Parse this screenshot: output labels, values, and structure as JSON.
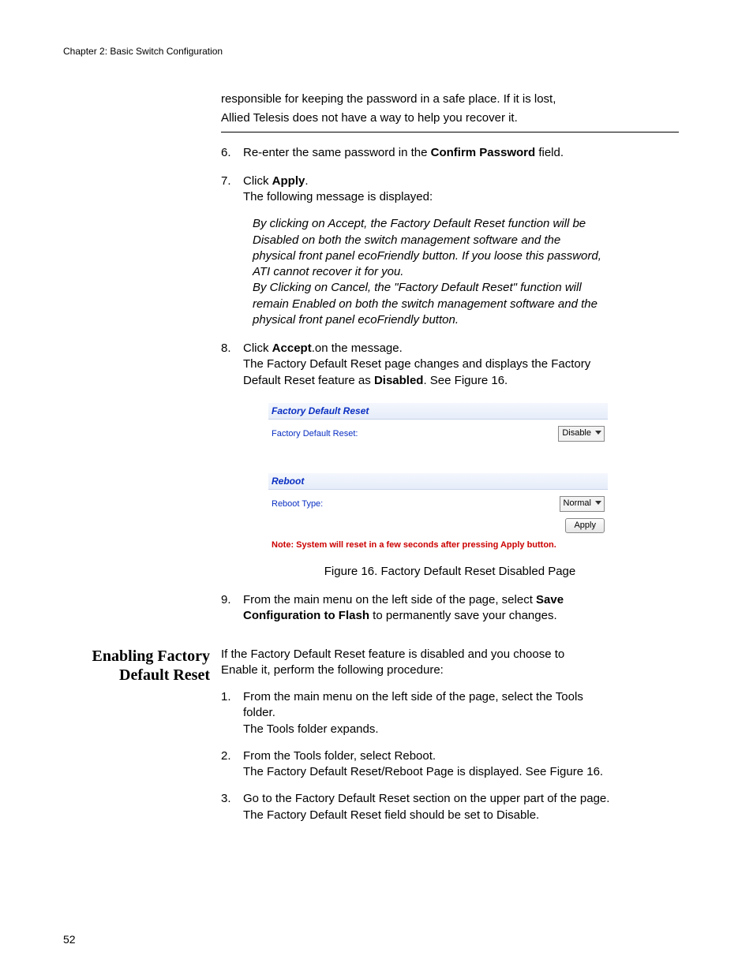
{
  "runhead": "Chapter 2: Basic Switch Configuration",
  "intro": {
    "line1": "responsible for keeping the password in a safe place. If it is lost,",
    "line2": "Allied Telesis does not have a way to help you recover it."
  },
  "items": {
    "6": {
      "n": "6.",
      "t1a": "Re-enter the same password in the ",
      "t1b": "Confirm Password",
      "t1c": " field."
    },
    "7": {
      "n": "7.",
      "t1a": "Click ",
      "t1b": "Apply",
      "t1c": ".",
      "t2": "The following message is displayed:"
    },
    "msg": {
      "l1": "By clicking on Accept, the Factory Default Reset function will be",
      "l2": "Disabled on both the switch management software and the",
      "l3": "physical front panel ecoFriendly button. If you loose this password,",
      "l4": "ATI cannot recover it for you.",
      "l5": "By Clicking on Cancel, the \"Factory Default Reset\" function will",
      "l6": "remain Enabled on both the switch management software and the",
      "l7": "physical front panel ecoFriendly button."
    },
    "8": {
      "n": "8.",
      "t1a": "Click ",
      "t1b": "Accept",
      "t1c": ".on the message.",
      "t2": "The Factory Default Reset page changes and displays the Factory",
      "t3a": "Default Reset feature as ",
      "t3b": "Disabled",
      "t3c": ". See Figure 16."
    },
    "9": {
      "n": "9.",
      "t1a": "From the main menu on the left side of the page, select ",
      "t1b": "Save",
      "t2a": "Configuration to Flash",
      "t2b": " to permanently save your changes."
    }
  },
  "uishot": {
    "fdr_title": "Factory Default Reset",
    "fdr_label": "Factory Default Reset:",
    "fdr_value": "Disable",
    "rb_title": "Reboot",
    "rb_label": "Reboot Type:",
    "rb_value": "Normal",
    "apply": "Apply",
    "note": "Note: System will reset in a few seconds after pressing Apply button."
  },
  "figcap": "Figure 16. Factory Default Reset Disabled Page",
  "sidehead": {
    "l1": "Enabling Factory",
    "l2": "Default Reset"
  },
  "sidebody": {
    "intro1": "If the Factory Default Reset feature is disabled and you choose to",
    "intro2a": "Enable",
    "intro2b": " it, perform the following procedure:",
    "1": {
      "n": "1.",
      "t1a": "From the main menu on the left side of the page, select the ",
      "t1b": "Tools",
      "t2": "folder.",
      "t3a": "The ",
      "t3b": "Tools",
      "t3c": " folder expands."
    },
    "2": {
      "n": "2.",
      "t1a": "From the ",
      "t1b": "Tools",
      "t1c": " folder, select ",
      "t1d": "Reboot",
      "t1e": ".",
      "t2": "The Factory Default Reset/Reboot Page is displayed. See Figure 16."
    },
    "3": {
      "n": "3.",
      "t1": "Go to the Factory Default Reset section on the upper part of the page.",
      "t2a": "The ",
      "t2b": "Factory Default Reset",
      "t2c": " field should be set to ",
      "t2d": "Disable",
      "t2e": "."
    }
  },
  "pagenum": "52"
}
